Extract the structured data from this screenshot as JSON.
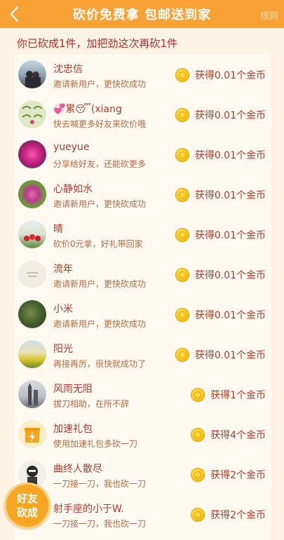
{
  "header": {
    "title": "砍价免费拿 包邮送到家",
    "rules_label": "规则",
    "back_icon": "chevron-left-icon"
  },
  "banner": "你已砍成1件，加把劲这次再砍1件",
  "fab": {
    "line1": "好友",
    "line2": "砍成"
  },
  "colors": {
    "header": "#f8a236",
    "accent_text": "#b03a28",
    "coin": "#f9c31a"
  },
  "helpers": [
    {
      "name": "沈忠信",
      "desc": "邀请新用户，更快砍成功",
      "reward": "获得0.01个金币"
    },
    {
      "name": "💞累😴(xiang",
      "desc": "快去喊更多好友来砍价哦",
      "reward": "获得0.01个金币"
    },
    {
      "name": "yueyue",
      "desc": "分享给好友，还能砍更多",
      "reward": "获得0.01个金币"
    },
    {
      "name": "心静如水",
      "desc": "邀请新用户，更快砍成功",
      "reward": "获得0.01个金币"
    },
    {
      "name": "晴",
      "desc": "砍价0元拿，好礼带回家",
      "reward": "获得0.01个金币"
    },
    {
      "name": "流年",
      "desc": "邀请新用户，更快砍成功",
      "reward": "获得0.01个金币"
    },
    {
      "name": "小米",
      "desc": "邀请新用户，更快砍成功",
      "reward": "获得0.01个金币"
    },
    {
      "name": "阳光",
      "desc": "再接再厉，很快就成功了",
      "reward": "获得0.01个金币"
    },
    {
      "name": "风雨无阻",
      "desc": "拔刀相助，在所不辞",
      "reward": "获得1个金币"
    },
    {
      "name": "加速礼包",
      "desc": "使用加速礼包多砍一刀",
      "reward": "获得4个金币"
    },
    {
      "name": "曲终人散尽",
      "desc": "一刀接一刀，我也砍一刀",
      "reward": "获得2个金币"
    },
    {
      "name": "射手座的小于W.",
      "desc": "一刀接一刀，我也砍一刀",
      "reward": "获得2个金币"
    }
  ]
}
